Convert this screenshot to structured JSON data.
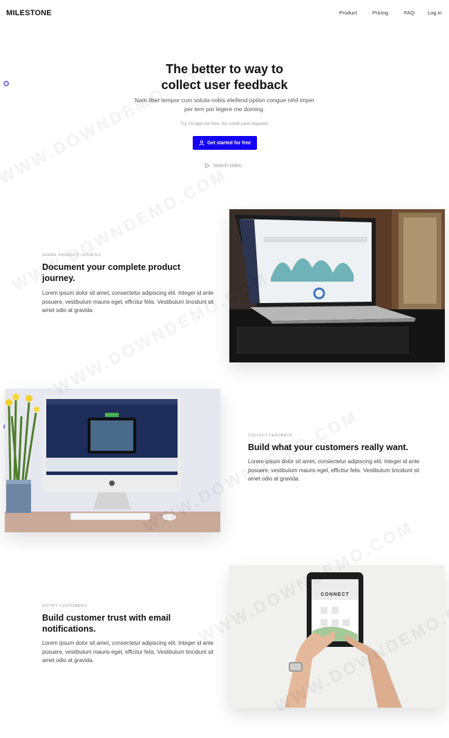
{
  "brand": {
    "name": "MILESTONE"
  },
  "nav": {
    "links": [
      "Product",
      "Pricing",
      "FAQ",
      "Log in"
    ]
  },
  "hero": {
    "title_line1": "The better to way to",
    "title_line2": "collect user feedback",
    "subtitle": "Nam liber tempor cum soluta nobis eleifend option congue nihil imper per tem por legere me doming.",
    "note": "Try 14 days for free. No credit card required.",
    "cta_label": "Get started for free",
    "watch_label": "Watch video"
  },
  "features": [
    {
      "label": "SHARE PRODUCT UPDATES",
      "title": "Document your complete product journey.",
      "body": "Lorem ipsum dolor sit amet, consectetur adipiscing elit. Integer id ante posuere, vestibulum mauris eget, efficitur felis. Vestibulum tincidunt sit amet odio at gravida."
    },
    {
      "label": "COLLECT FEEDBACK",
      "title": "Build what your customers really want.",
      "body": "Lorem ipsum dolor sit amet, consectetur adipiscing elit. Integer id ante posuere, vestibulum mauris eget, efficitur felis. Vestibulum tincidunt sit amet odio at gravida."
    },
    {
      "label": "NOTIFY CUSTOMERS",
      "title": "Build customer trust with email notifications.",
      "body": "Lorem ipsum dolor sit amet, consectetur adipiscing elit. Integer id ante posuere, vestibulum mauris eget, efficitur felis. Vestibulum tincidunt sit amet odio at gravida."
    }
  ],
  "tablet_screen": {
    "word": "CONNECT"
  },
  "watermark": "WWW.DOWNDEMO.COM",
  "colors": {
    "accent": "#1400f5",
    "side_dot": "#7b6cf0"
  },
  "icons": {
    "cta": "user-icon",
    "watch": "play-icon",
    "side": "settings-dot-icon"
  }
}
